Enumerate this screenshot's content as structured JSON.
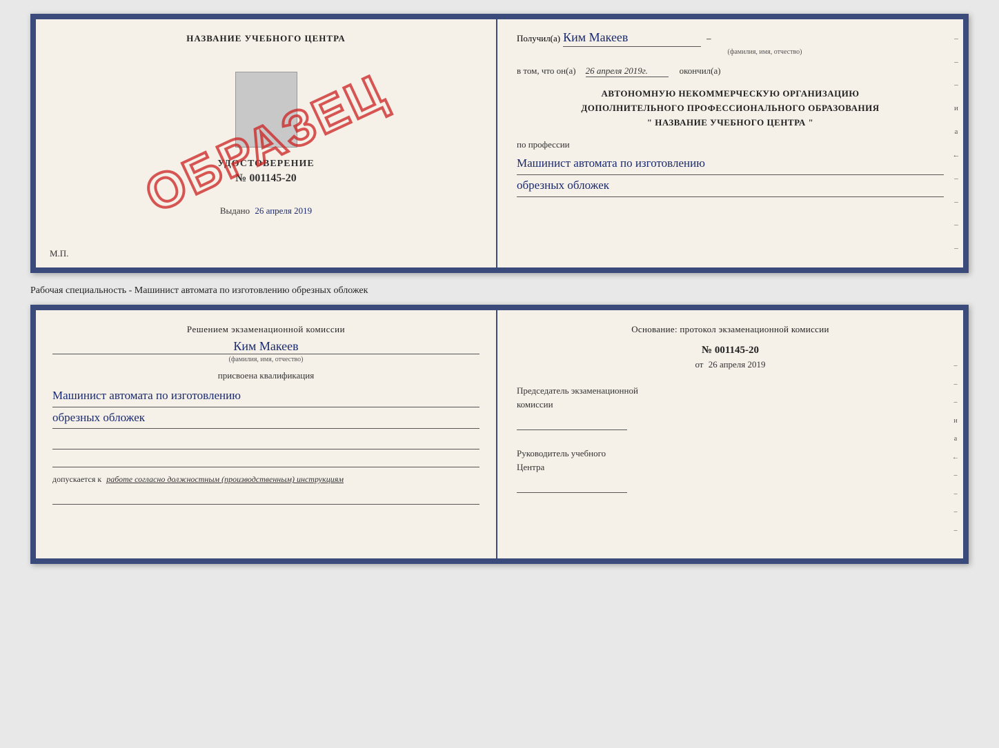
{
  "topDoc": {
    "left": {
      "trainingCenterTitle": "НАЗВАНИЕ УЧЕБНОГО ЦЕНТРА",
      "certificateLabel": "УДОСТОВЕРЕНИЕ",
      "certificateNumber": "№ 001145-20",
      "issuedLabel": "Выдано",
      "issuedDate": "26 апреля 2019",
      "mpLabel": "М.П.",
      "sampleStamp": "ОБРАЗЕЦ"
    },
    "right": {
      "recipientLabel": "Получил(а)",
      "recipientName": "Ким Макеев",
      "recipientDash": "–",
      "fioHint": "(фамилия, имя, отчество)",
      "completedLabel": "в том, что он(а)",
      "completedDate": "26 апреля 2019г.",
      "completedAfter": "окончил(а)",
      "orgLine1": "АВТОНОМНУЮ НЕКОММЕРЧЕСКУЮ ОРГАНИЗАЦИЮ",
      "orgLine2": "ДОПОЛНИТЕЛЬНОГО ПРОФЕССИОНАЛЬНОГО ОБРАЗОВАНИЯ",
      "orgLine3": "\"   НАЗВАНИЕ УЧЕБНОГО ЦЕНТРА   \"",
      "professionLabel": "по профессии",
      "professionVal1": "Машинист автомата по изготовлению",
      "professionVal2": "обрезных обложек",
      "sideDashes": [
        "-",
        "-",
        "-",
        "и",
        "а",
        "←",
        "-",
        "-",
        "-",
        "-"
      ]
    }
  },
  "middleText": "Рабочая специальность - Машинист автомата по изготовлению обрезных обложек",
  "bottomDoc": {
    "left": {
      "decisionTitle": "Решением экзаменационной комиссии",
      "decisionName": "Ким Макеев",
      "fioHint": "(фамилия, имя, отчество)",
      "qualAssigned": "присвоена квалификация",
      "qualVal1": "Машинист автомата по изготовлению",
      "qualVal2": "обрезных обложек",
      "admissionLabel": "допускается к",
      "admissionText": "работе согласно должностным (производственным) инструкциям"
    },
    "right": {
      "basisTitle": "Основание: протокол экзаменационной комиссии",
      "protocolNumber": "№ 001145-20",
      "protocolDatePrefix": "от",
      "protocolDate": "26 апреля 2019",
      "chairmanTitle1": "Председатель экзаменационной",
      "chairmanTitle2": "комиссии",
      "headTitle1": "Руководитель учебного",
      "headTitle2": "Центра",
      "sideDashes": [
        "-",
        "-",
        "-",
        "и",
        "а",
        "←",
        "-",
        "-",
        "-",
        "-"
      ]
    }
  }
}
